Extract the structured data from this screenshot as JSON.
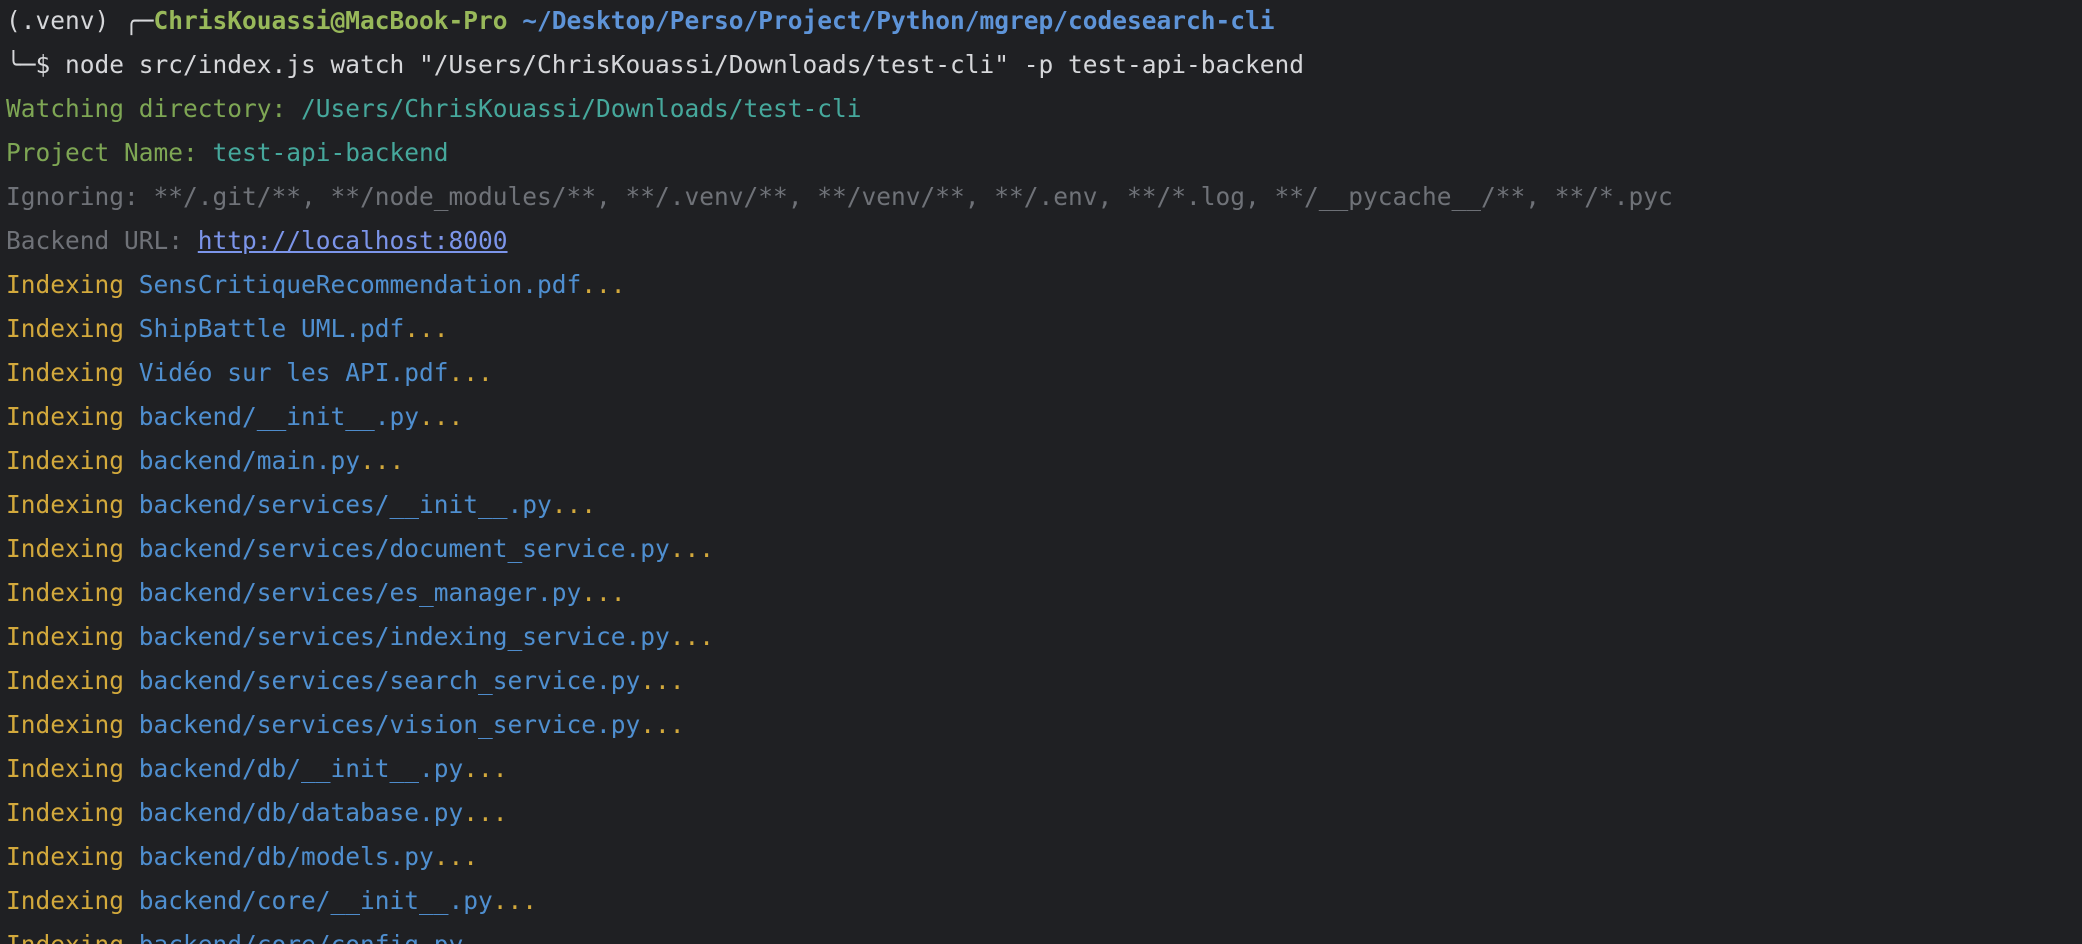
{
  "prompt": {
    "venv": "(.venv) ",
    "corner_top": "╭─",
    "user_host": "ChrisKouassi@MacBook-Pro",
    "cwd": " ~/Desktop/Perso/Project/Python/mgrep/codesearch-cli",
    "corner_bottom": "╰─",
    "symbol": "$ ",
    "command": "node src/index.js watch \"/Users/ChrisKouassi/Downloads/test-cli\" -p test-api-backend"
  },
  "info": {
    "watching_label": "Watching directory: ",
    "watching_value": "/Users/ChrisKouassi/Downloads/test-cli",
    "project_label": "Project Name: ",
    "project_value": "test-api-backend",
    "ignoring": "Ignoring: **/.git/**, **/node_modules/**, **/.venv/**, **/venv/**, **/.env, **/*.log, **/__pycache__/**, **/*.pyc",
    "backend_label": "Backend URL: ",
    "backend_url": "http://localhost:8000"
  },
  "indexing": {
    "prefix": "Indexing ",
    "suffix": "...",
    "files": [
      "SensCritiqueRecommendation.pdf",
      "ShipBattle UML.pdf",
      "Vidéo sur les API.pdf",
      "backend/__init__.py",
      "backend/main.py",
      "backend/services/__init__.py",
      "backend/services/document_service.py",
      "backend/services/es_manager.py",
      "backend/services/indexing_service.py",
      "backend/services/search_service.py",
      "backend/services/vision_service.py",
      "backend/db/__init__.py",
      "backend/db/database.py",
      "backend/db/models.py",
      "backend/core/__init__.py",
      "backend/core/config.py"
    ]
  },
  "colors": {
    "background": "#1f2023",
    "user_host": "#98b85a",
    "cwd": "#5e94d8",
    "label_green": "#7ea654",
    "value_teal": "#46a89c",
    "muted_gray": "#6f7278",
    "link": "#7c95ea",
    "indexing_yellow": "#d3a93c",
    "file_blue": "#4f8fd0"
  }
}
